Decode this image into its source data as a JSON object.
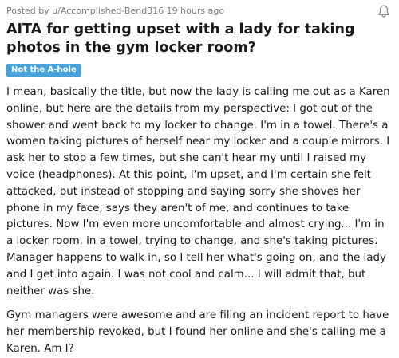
{
  "post": {
    "meta": "Posted by u/Accomplished-Bend316 19 hours ago",
    "title": "AITA for getting upset with a lady for taking photos in the gym locker room?",
    "flair": "Not the A-hole",
    "paragraphs": [
      "I mean, basically the title, but now the lady is calling me out as a Karen online, but here are the details from my perspective: I got out of the shower and went back to my locker to change. I'm in a towel. There's a women taking pictures of herself near my locker and a couple mirrors. I ask her to stop a few times, but she can't hear my until I raised my voice (headphones). At this point, I'm upset, and I'm certain she felt attacked, but instead of stopping and saying sorry she shoves her phone in my face, says they aren't of me, and continues to take pictures. Now I'm even more uncomfortable and almost crying... I'm in a locker room, in a towel, trying to change, and she's taking pictures. Manager happens to walk in, so I tell her what's going on, and the lady and I get into again. I was not cool and calm... I will admit that, but neither was she.",
      "Gym managers were awesome and are filing an incident report to have her membership revoked, but I found her online and she's calling me a Karen. Am I?"
    ],
    "icons": {
      "notification": "bell-icon"
    },
    "colors": {
      "flair_bg": "#46a2d8",
      "meta_text": "#787c7e",
      "body_text": "#1a1a1b"
    }
  }
}
